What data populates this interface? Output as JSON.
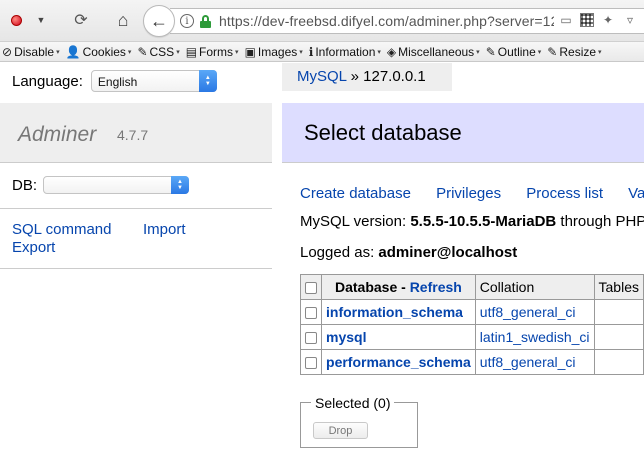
{
  "browser": {
    "url_host": "https://dev-freebsd.difyel.com",
    "url_path": "/adminer.php?server=12",
    "info_glyph": "i",
    "history_glyph": "⟳",
    "home_glyph": "⌂",
    "back_glyph": "←",
    "icons": [
      "record-icon",
      "menu-caret-icon",
      "history-icon",
      "home-icon",
      "back-arrow-icon",
      "info-icon",
      "lock-icon",
      "hardware-icon",
      "qr-icon",
      "gear-icon",
      "pocket-icon"
    ]
  },
  "webdev_toolbar": {
    "items": [
      {
        "glyph": "⊘",
        "label": "Disable"
      },
      {
        "glyph": "👤",
        "label": "Cookies"
      },
      {
        "glyph": "✎",
        "label": "CSS"
      },
      {
        "glyph": "▤",
        "label": "Forms"
      },
      {
        "glyph": "▣",
        "label": "Images"
      },
      {
        "glyph": "ℹ",
        "label": "Information"
      },
      {
        "glyph": "◈",
        "label": "Miscellaneous"
      },
      {
        "glyph": "✎",
        "label": "Outline"
      },
      {
        "glyph": "✎",
        "label": "Resize"
      }
    ],
    "caret": "▾"
  },
  "menu": {
    "language_label": "Language:",
    "language_value": "English",
    "app_name": "Adminer",
    "app_version": "4.7.7",
    "db_label": "DB:",
    "db_value": "",
    "sql_command": "SQL command",
    "import": "Import",
    "export": "Export"
  },
  "breadcrumb": {
    "driver": "MySQL",
    "separator": "»",
    "server": "127.0.0.1"
  },
  "content": {
    "title": "Select database",
    "actions": [
      "Create database",
      "Privileges",
      "Process list",
      "Variables"
    ],
    "version_label": "MySQL version:",
    "version_value": "5.5.5-10.5.5-MariaDB",
    "version_suffix": "through PHP extension MySQLi",
    "logged_label": "Logged as:",
    "logged_value": "adminer@localhost",
    "table": {
      "header_database": "Database",
      "header_dash": "-",
      "header_refresh": "Refresh",
      "header_collation": "Collation",
      "header_tables": "Tables",
      "rows": [
        {
          "name": "information_schema",
          "collation": "utf8_general_ci"
        },
        {
          "name": "mysql",
          "collation": "latin1_swedish_ci"
        },
        {
          "name": "performance_schema",
          "collation": "utf8_general_ci"
        }
      ]
    },
    "selected_legend": "Selected (0)",
    "drop_button": "Drop"
  }
}
